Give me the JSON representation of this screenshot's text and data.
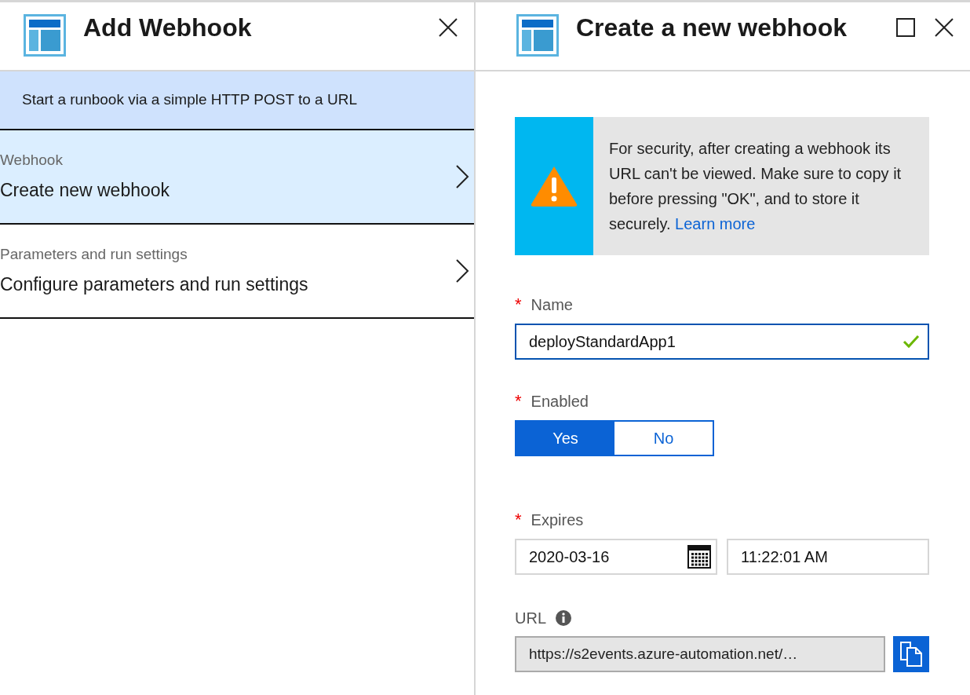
{
  "left_blade": {
    "title": "Add Webhook",
    "description": "Start a runbook via a simple HTTP POST to a URL",
    "sections": [
      {
        "label": "Webhook",
        "value": "Create new webhook",
        "selected": true
      },
      {
        "label": "Parameters and run settings",
        "value": "Configure parameters and run settings",
        "selected": false
      }
    ]
  },
  "right_blade": {
    "title": "Create a new webhook",
    "notice": {
      "text": "For security, after creating a webhook its URL can't be viewed. Make sure to copy it before pressing \"OK\", and to store it securely.",
      "link": "Learn more"
    },
    "fields": [
      {
        "kind": "text",
        "label": "Name",
        "required_mark": "*",
        "value": "deployStandardApp1",
        "valid": true
      },
      {
        "kind": "toggle",
        "label": "Enabled",
        "required_mark": "*",
        "options": [
          {
            "label": "Yes",
            "selected": true
          },
          {
            "label": "No",
            "selected": false
          }
        ]
      },
      {
        "kind": "datetime",
        "label": "Expires",
        "required_mark": "*",
        "date": "2020-03-16",
        "time": "11:22:01 AM"
      },
      {
        "kind": "url",
        "label": "URL",
        "value": "https://s2events.azure-automation.net/…"
      }
    ]
  }
}
